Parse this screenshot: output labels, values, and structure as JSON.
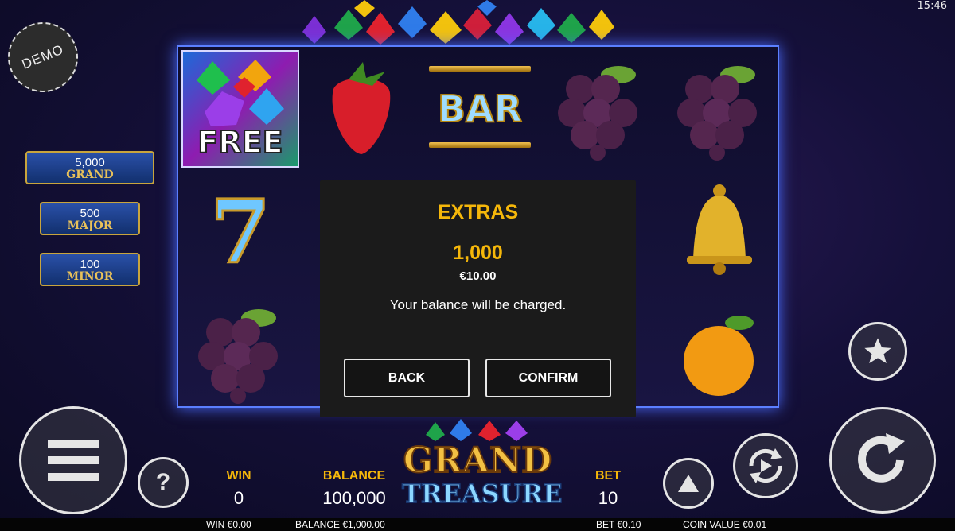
{
  "status_bar": {
    "time": "15:46"
  },
  "badge": {
    "demo": "DEMO"
  },
  "jackpots": [
    {
      "amount": "5,000",
      "label": "GRAND"
    },
    {
      "amount": "500",
      "label": "MAJOR"
    },
    {
      "amount": "100",
      "label": "MINOR"
    }
  ],
  "reels": {
    "free_label": "FREE",
    "bar_label": "BAR",
    "seven_label": "7",
    "bar_label_partial": "B"
  },
  "modal": {
    "title": "EXTRAS",
    "amount": "1,000",
    "money": "€10.00",
    "message": "Your balance will be charged.",
    "back_label": "BACK",
    "confirm_label": "CONFIRM"
  },
  "logo": {
    "line1": "GRAND",
    "line2": "TREASURE"
  },
  "stats": {
    "win_label": "WIN",
    "win_value": "0",
    "balance_label": "BALANCE",
    "balance_value": "100,000",
    "bet_label": "BET",
    "bet_value": "10"
  },
  "controls": {
    "help": "?"
  },
  "footer": {
    "win": "WIN €0.00",
    "balance": "BALANCE €1,000.00",
    "bet": "BET €0.10",
    "coin_value": "COIN VALUE €0.01"
  },
  "colors": {
    "accent": "#f5b70a",
    "reel_border": "#5b7fff",
    "modal_bg": "#1b1b1b"
  }
}
